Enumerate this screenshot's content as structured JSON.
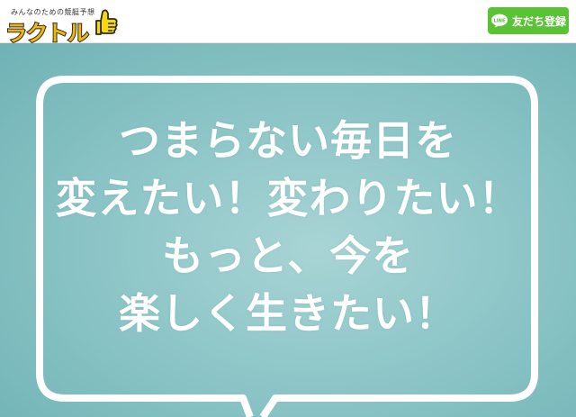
{
  "header": {
    "logo": {
      "tagline": "みんなのための競艇予想",
      "text": "ラクトル"
    },
    "line_button": {
      "icon_label": "LINE",
      "label": "友だち登録"
    }
  },
  "hero": {
    "headline_lines": [
      "つまらない毎日を",
      "変えたい！変わりたい！",
      "もっと、今を",
      "楽しく生きたい！"
    ]
  },
  "colors": {
    "hero_background": "#8ec6c8",
    "line_green": "#5ac235",
    "logo_yellow": "#f2b705"
  }
}
